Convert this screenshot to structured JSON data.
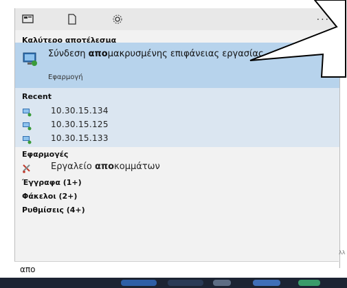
{
  "section_best": "Καλύτερο αποτέλεσμα",
  "best": {
    "title_before": "Σύνδεση ",
    "title_bold": "απο",
    "title_after": "μακρυσμένης επιφάνειας εργασίας",
    "subtitle": "Εφαρμογή"
  },
  "section_recent": "Recent",
  "recent": [
    "10.30.15.134",
    "10.30.15.125",
    "10.30.15.133"
  ],
  "section_apps": "Εφαρμογές",
  "app": {
    "label_before": "Εργαλείο ",
    "label_bold": "απο",
    "label_after": "κομμάτων"
  },
  "documents": "Έγγραφα (1+)",
  "folders": "Φάκελοι (2+)",
  "settings": "Ρυθμίσεις (4+)",
  "search": {
    "value": "απο"
  },
  "more_label": "···",
  "edge_text": "λλ",
  "colors": {
    "highlight": "#b7d3ec",
    "recent_bg": "#dbe6f1",
    "taskbar": "#1c2433"
  }
}
